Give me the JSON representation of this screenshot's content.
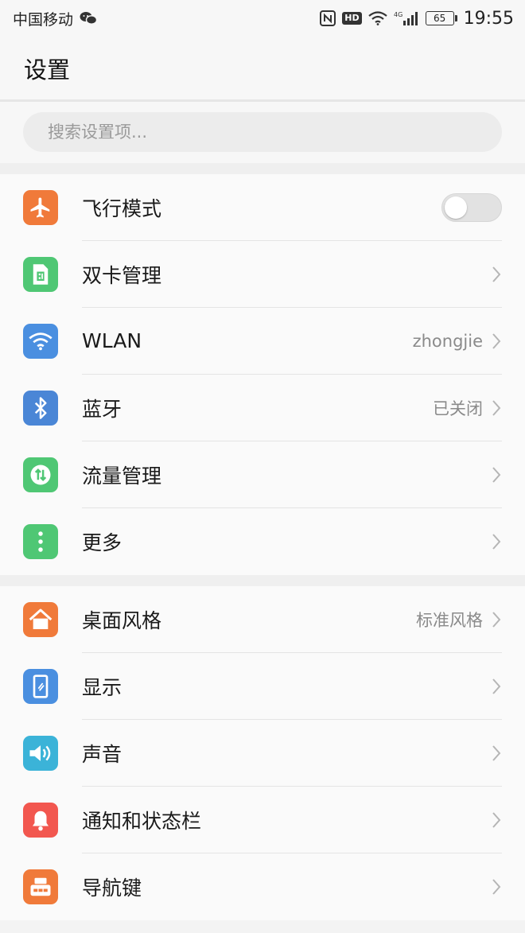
{
  "status_bar": {
    "carrier": "中国移动",
    "hd_badge": "HD",
    "network": "4G",
    "battery": "65",
    "time": "19:55"
  },
  "header": {
    "title": "设置"
  },
  "search": {
    "placeholder": "搜索设置项..."
  },
  "colors": {
    "orange": "#f07a3a",
    "green": "#4fc774",
    "blue": "#4a8fe0",
    "bt_blue": "#4a86d6",
    "teal": "#3bb3d8",
    "red": "#f2574f"
  },
  "group1": {
    "airplane": {
      "label": "飞行模式",
      "icon": "airplane-icon",
      "toggle_on": false
    },
    "dual_sim": {
      "label": "双卡管理",
      "icon": "sim-card-icon"
    },
    "wlan": {
      "label": "WLAN",
      "value": "zhongjie",
      "icon": "wifi-icon"
    },
    "bluetooth": {
      "label": "蓝牙",
      "value": "已关闭",
      "icon": "bluetooth-icon"
    },
    "data": {
      "label": "流量管理",
      "icon": "data-usage-icon"
    },
    "more": {
      "label": "更多",
      "icon": "more-dots-icon"
    }
  },
  "group2": {
    "home_style": {
      "label": "桌面风格",
      "value": "标准风格",
      "icon": "home-icon"
    },
    "display": {
      "label": "显示",
      "icon": "display-icon"
    },
    "sound": {
      "label": "声音",
      "icon": "speaker-icon"
    },
    "notifications": {
      "label": "通知和状态栏",
      "icon": "bell-icon"
    },
    "nav_keys": {
      "label": "导航键",
      "icon": "navigation-key-icon"
    }
  }
}
